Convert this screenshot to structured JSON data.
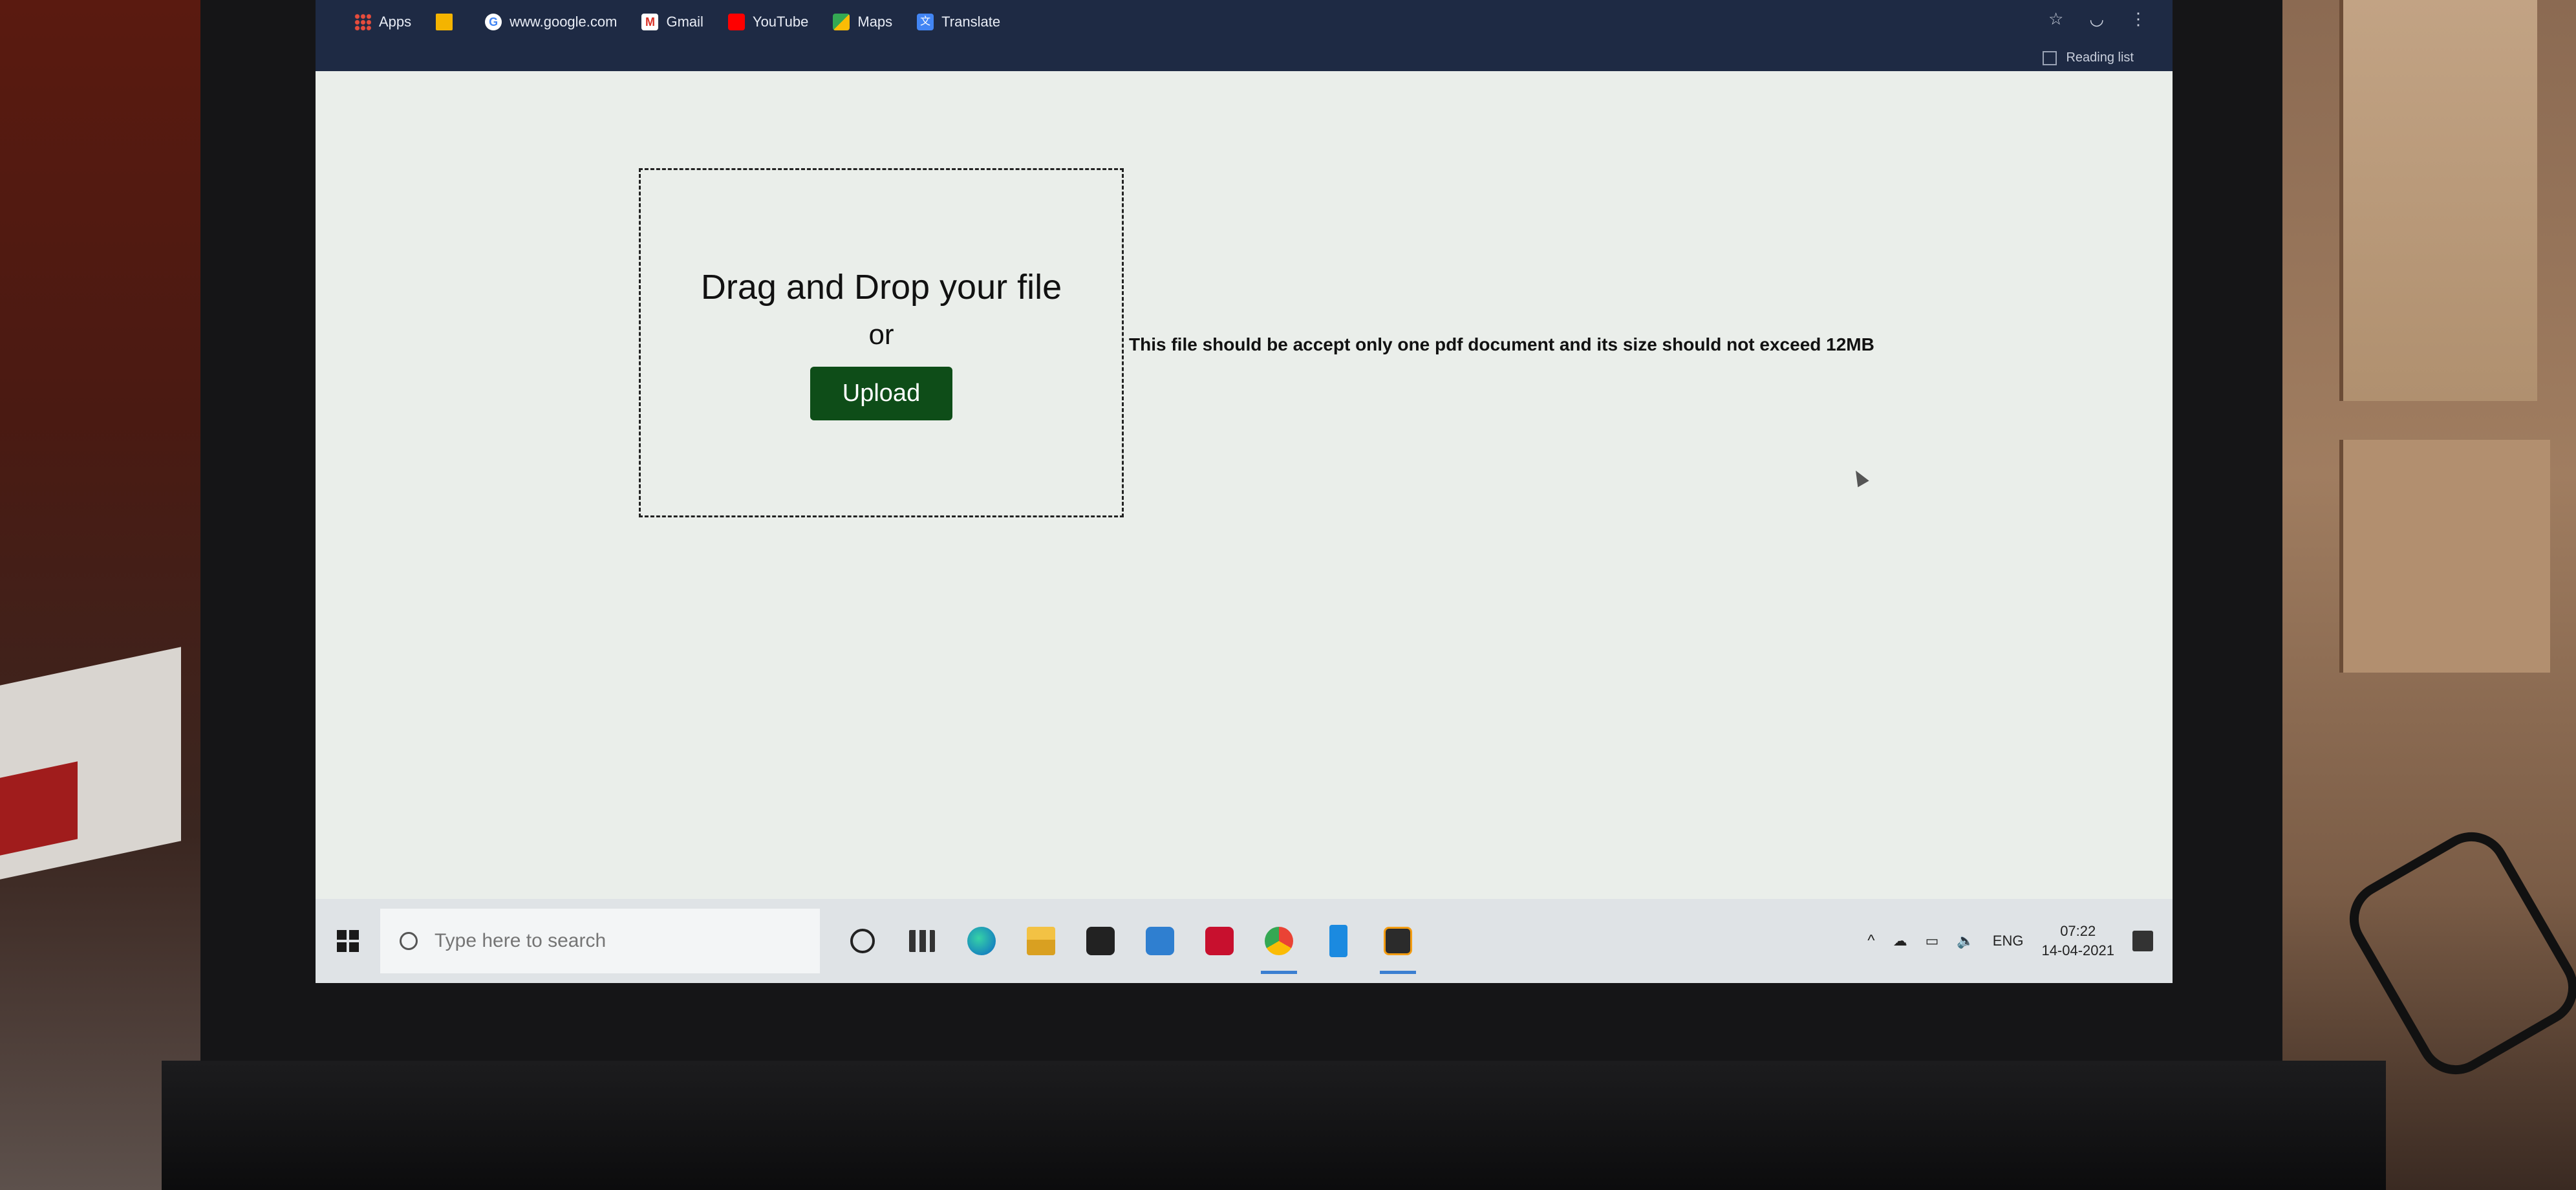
{
  "bookmarks": {
    "items": [
      {
        "label": "Apps",
        "icon": "apps-grid-icon"
      },
      {
        "label": "",
        "icon": "folder-icon"
      },
      {
        "label": "www.google.com",
        "icon": "google-icon"
      },
      {
        "label": "Gmail",
        "icon": "gmail-icon"
      },
      {
        "label": "YouTube",
        "icon": "youtube-icon"
      },
      {
        "label": "Maps",
        "icon": "maps-icon"
      },
      {
        "label": "Translate",
        "icon": "translate-icon"
      }
    ],
    "reading_list": "Reading list"
  },
  "upload": {
    "title": "Drag and Drop your file",
    "or": "or",
    "button": "Upload",
    "note": "This file should be accept only one pdf document and its size should not exceed 12MB"
  },
  "taskbar": {
    "search_placeholder": "Type here to search",
    "language": "ENG",
    "time": "07:22",
    "date": "14-04-2021"
  },
  "colors": {
    "upload_button": "#0e4d18",
    "bookmarks_bar": "#1e2a44",
    "page_background": "#eaeeea"
  }
}
